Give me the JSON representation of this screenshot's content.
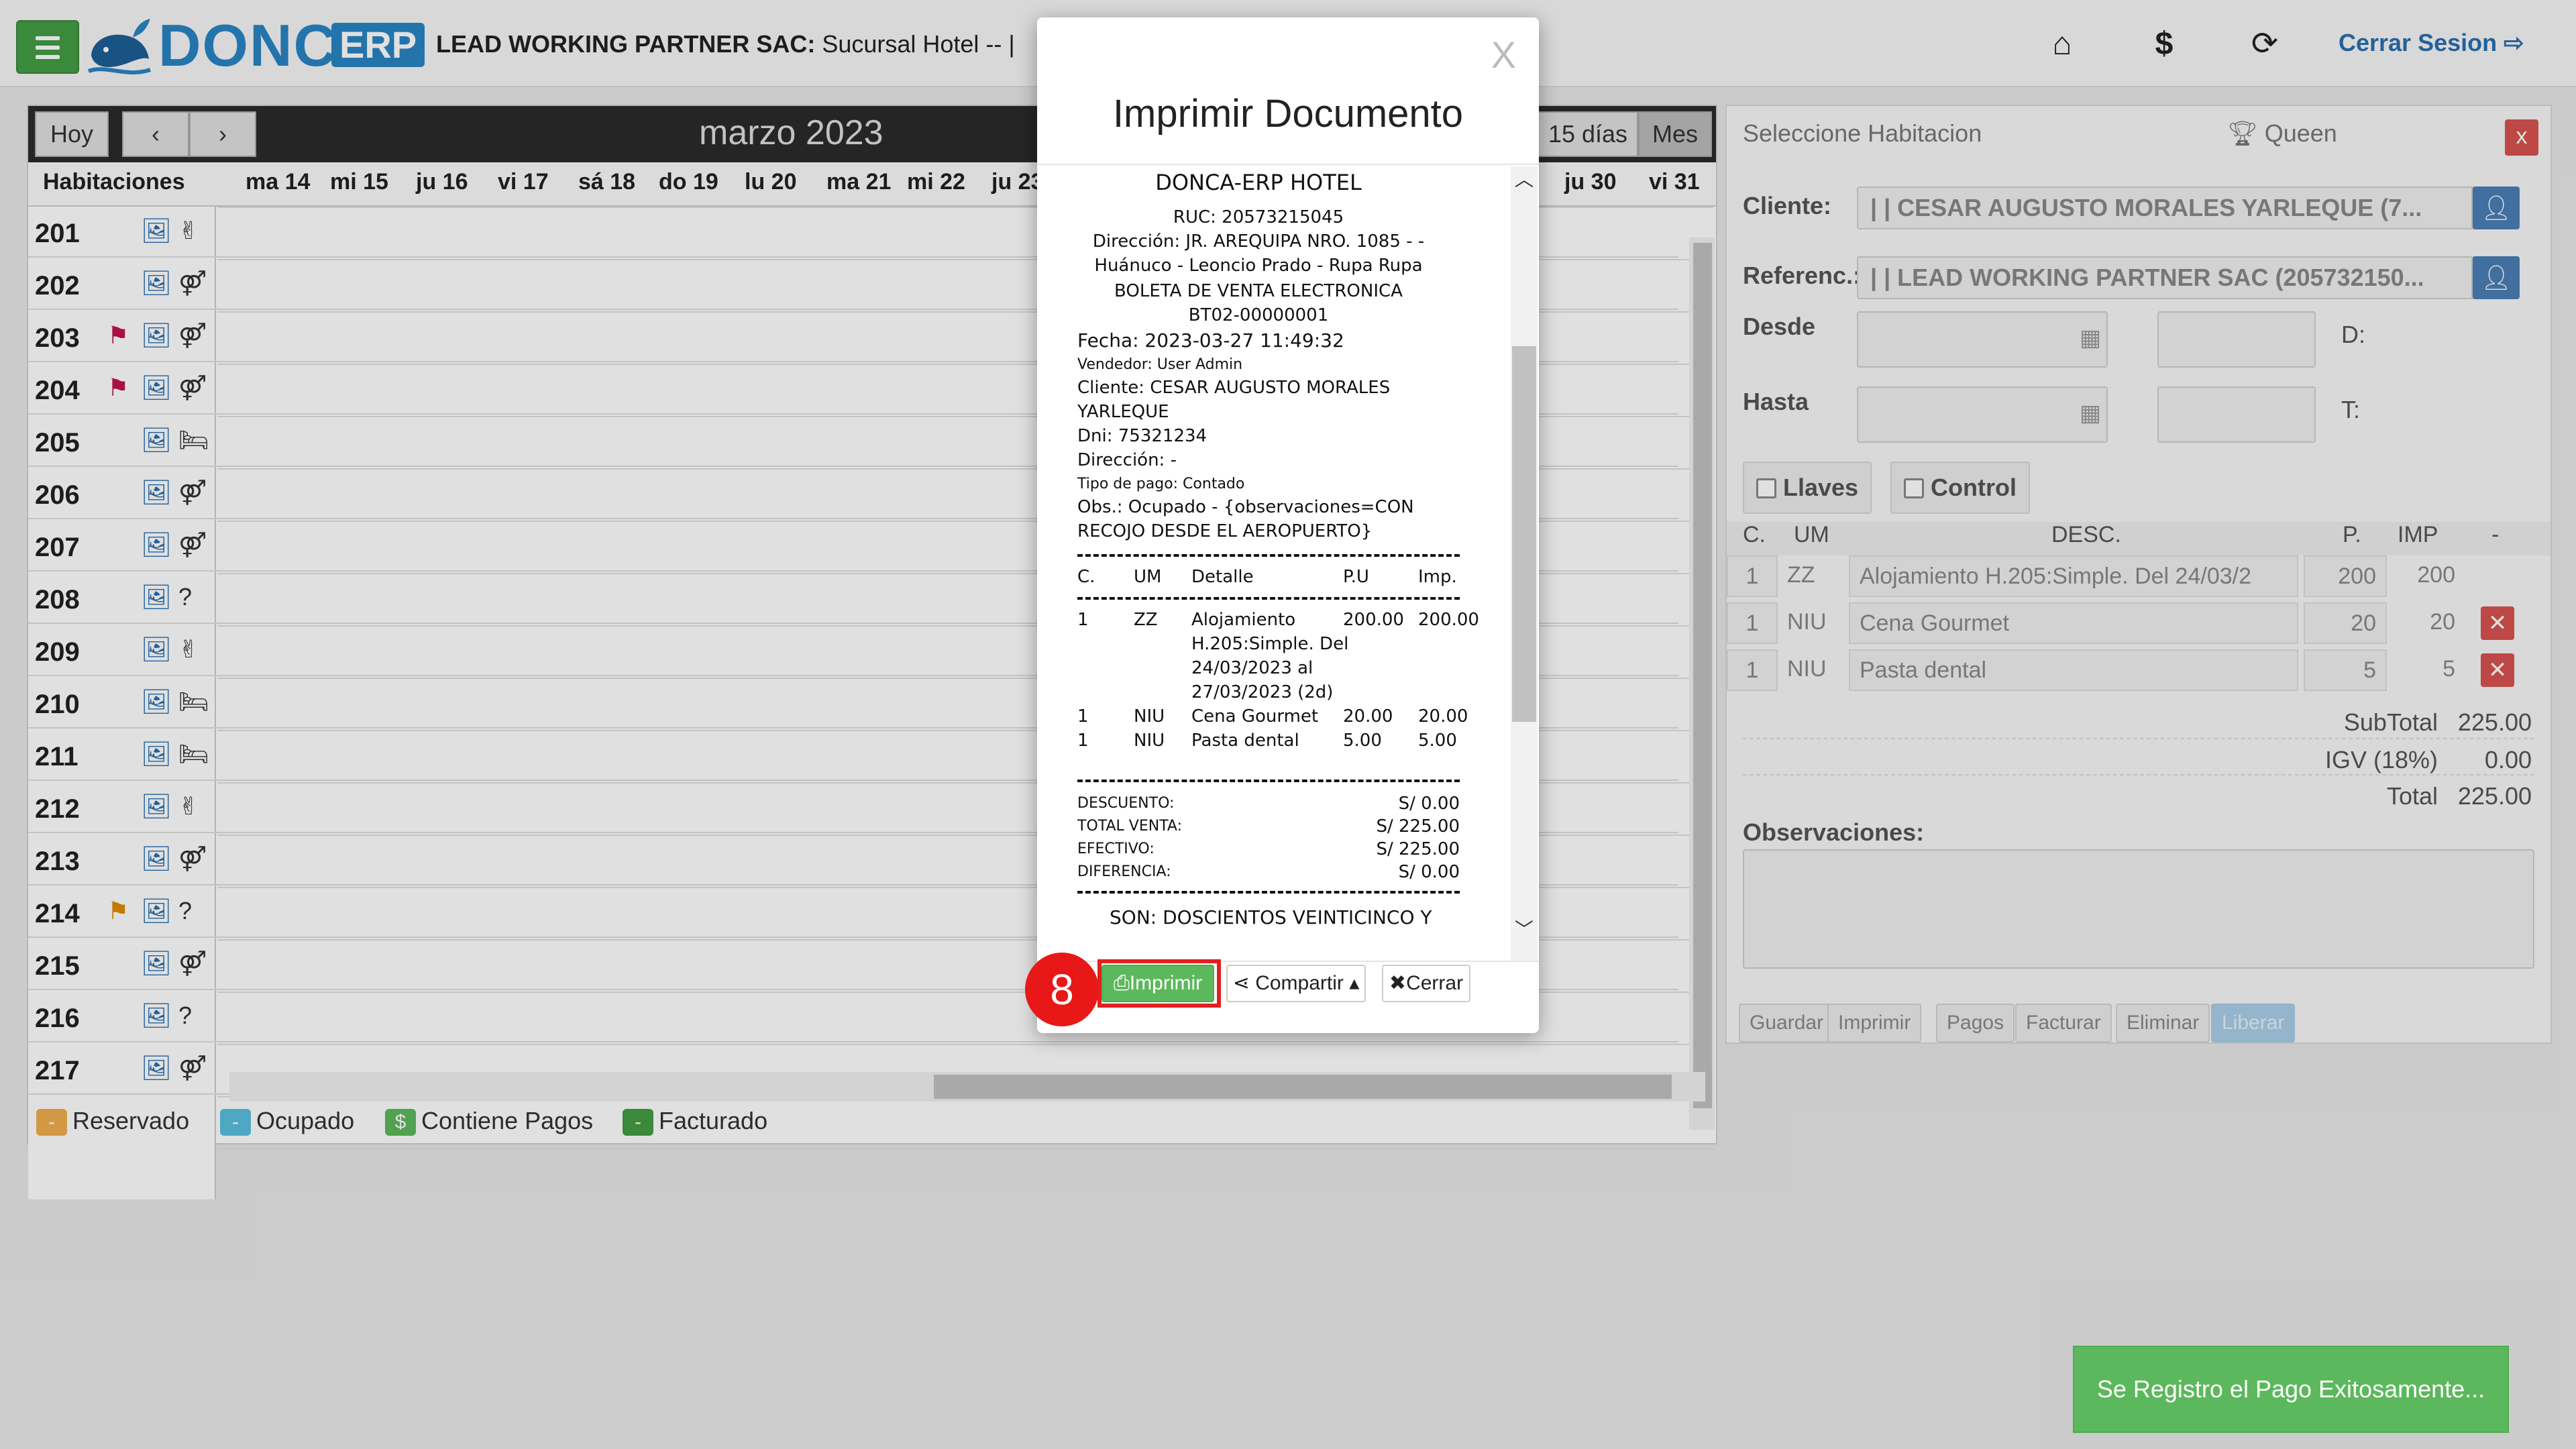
{
  "header": {
    "brand": "DONCA",
    "brand_suffix": "ERP",
    "company_bold": "LEAD WORKING PARTNER SAC:",
    "company_branch": "Sucursal Hotel -- |",
    "logout_label": "Cerrar Sesion",
    "icons": [
      "menu-icon",
      "home-icon",
      "dollar-icon",
      "lock-reset-icon",
      "logout-icon"
    ]
  },
  "calendar": {
    "today_label": "Hoy",
    "month_title": "marzo 2023",
    "view_15": "15 días",
    "view_month": "Mes",
    "rooms_header": "Habitaciones",
    "days": [
      "ma 14",
      "mi 15",
      "ju 16",
      "vi 17",
      "sá 18",
      "do 19",
      "lu 20",
      "ma 21",
      "mi 22",
      "ju 23",
      "ju 30",
      "vi 31"
    ],
    "rooms": [
      {
        "num": "201",
        "flag": "",
        "icons": [
          "image-icon",
          "peace-icon"
        ]
      },
      {
        "num": "202",
        "flag": "",
        "icons": [
          "image-icon",
          "couple-icon"
        ]
      },
      {
        "num": "203",
        "flag": "red",
        "icons": [
          "image-icon",
          "couple-icon"
        ]
      },
      {
        "num": "204",
        "flag": "red",
        "icons": [
          "image-icon",
          "couple-icon"
        ]
      },
      {
        "num": "205",
        "flag": "",
        "icons": [
          "image-icon",
          "bed-icon"
        ]
      },
      {
        "num": "206",
        "flag": "",
        "icons": [
          "image-icon",
          "couple-icon"
        ]
      },
      {
        "num": "207",
        "flag": "",
        "icons": [
          "image-icon",
          "couple-icon"
        ]
      },
      {
        "num": "208",
        "flag": "",
        "icons": [
          "image-icon",
          "question-icon"
        ]
      },
      {
        "num": "209",
        "flag": "",
        "icons": [
          "image-icon",
          "peace-icon"
        ]
      },
      {
        "num": "210",
        "flag": "",
        "icons": [
          "image-icon",
          "bed-icon"
        ]
      },
      {
        "num": "211",
        "flag": "",
        "icons": [
          "image-icon",
          "bed-icon"
        ]
      },
      {
        "num": "212",
        "flag": "",
        "icons": [
          "image-icon",
          "peace-icon"
        ]
      },
      {
        "num": "213",
        "flag": "",
        "icons": [
          "image-icon",
          "couple-icon"
        ]
      },
      {
        "num": "214",
        "flag": "orange",
        "icons": [
          "image-icon",
          "question-icon"
        ]
      },
      {
        "num": "215",
        "flag": "",
        "icons": [
          "image-icon",
          "couple-icon"
        ]
      },
      {
        "num": "216",
        "flag": "",
        "icons": [
          "image-icon",
          "question-icon"
        ]
      },
      {
        "num": "217",
        "flag": "",
        "icons": [
          "image-icon",
          "couple-icon"
        ]
      }
    ],
    "legend": [
      {
        "symbol": "-",
        "label": "Reservado",
        "color": "#f0ad4e"
      },
      {
        "symbol": "-",
        "label": "Ocupado",
        "color": "#5bc0de"
      },
      {
        "symbol": "$",
        "label": "Contiene Pagos",
        "color": "#5cb85c"
      },
      {
        "symbol": "-",
        "label": "Facturado",
        "color": "#449d44"
      }
    ]
  },
  "side_panel": {
    "title": "Seleccione Habitacion",
    "room_type": "Queen",
    "close_label": "x",
    "cliente_label": "Cliente:",
    "cliente_value": "| | CESAR AUGUSTO MORALES YARLEQUE (7...",
    "referencia_label": "Referenc.:",
    "referencia_value": "| | LEAD WORKING PARTNER SAC (205732150...",
    "desde_label": "Desde",
    "hasta_label": "Hasta",
    "d_label": "D:",
    "t_label": "T:",
    "llaves_label": "Llaves",
    "control_label": "Control",
    "table_headers": {
      "c": "C.",
      "um": "UM",
      "desc": "DESC.",
      "p": "P.",
      "imp": "IMP",
      "del": "-"
    },
    "items": [
      {
        "c": "1",
        "um": "ZZ",
        "desc": "Alojamiento H.205:Simple. Del 24/03/2",
        "p": "200",
        "imp": "200"
      },
      {
        "c": "1",
        "um": "NIU",
        "desc": "Cena Gourmet",
        "p": "20",
        "imp": "20"
      },
      {
        "c": "1",
        "um": "NIU",
        "desc": "Pasta dental",
        "p": "5",
        "imp": "5"
      }
    ],
    "subtotal_label": "SubTotal",
    "subtotal_value": "225.00",
    "igv_label": "IGV (18%)",
    "igv_value": "0.00",
    "total_label": "Total",
    "total_value": "225.00",
    "obs_label": "Observaciones:",
    "footer_buttons": [
      "Guardar",
      "Imprimir",
      "Pagos",
      "Facturar",
      "Eliminar",
      "Liberar"
    ]
  },
  "modal": {
    "close_label": "X",
    "title": "Imprimir Documento",
    "receipt": {
      "business": "DONCA-ERP HOTEL",
      "ruc": "RUC: 20573215045",
      "address1": "Dirección: JR. AREQUIPA NRO. 1085 - -",
      "address2": "Huánuco - Leoncio Prado - Rupa Rupa",
      "doc_type": "BOLETA DE VENTA ELECTRONICA",
      "doc_number": "BT02-00000001",
      "fecha": "Fecha: 2023-03-27 11:49:32",
      "vendedor": "Vendedor: User Admin",
      "cliente1": "Cliente: CESAR AUGUSTO MORALES",
      "cliente2": "YARLEQUE",
      "dni": "Dni: 75321234",
      "direccion": "Dirección: -",
      "tipo_pago": "Tipo de pago: Contado",
      "obs1": "Obs.: Ocupado - {observaciones=CON",
      "obs2": "RECOJO DESDE EL AEROPUERTO}",
      "col_c": "C.",
      "col_um": "UM",
      "col_detalle": "Detalle",
      "col_pu": "P.U",
      "col_imp": "Imp.",
      "lines": [
        {
          "c": "1",
          "um": "ZZ",
          "detalle": [
            "Alojamiento",
            "H.205:Simple. Del",
            "24/03/2023 al",
            "27/03/2023 (2d)"
          ],
          "pu": "200.00",
          "imp": "200.00"
        },
        {
          "c": "1",
          "um": "NIU",
          "detalle": [
            "Cena Gourmet"
          ],
          "pu": "20.00",
          "imp": "20.00"
        },
        {
          "c": "1",
          "um": "NIU",
          "detalle": [
            "Pasta dental"
          ],
          "pu": "5.00",
          "imp": "5.00"
        }
      ],
      "descuento_label": "DESCUENTO:",
      "descuento_value": "S/ 0.00",
      "total_venta_label": "TOTAL VENTA:",
      "total_venta_value": "S/ 225.00",
      "efectivo_label": "EFECTIVO:",
      "efectivo_value": "S/ 225.00",
      "diferencia_label": "DIFERENCIA:",
      "diferencia_value": "S/ 0.00",
      "son": "SON: DOSCIENTOS VEINTICINCO Y"
    },
    "print_label": "Imprimir",
    "share_label": "Compartir",
    "close_button_label": "Cerrar"
  },
  "step_badge": "8",
  "toast": "Se Registro el Pago Exitosamente..."
}
